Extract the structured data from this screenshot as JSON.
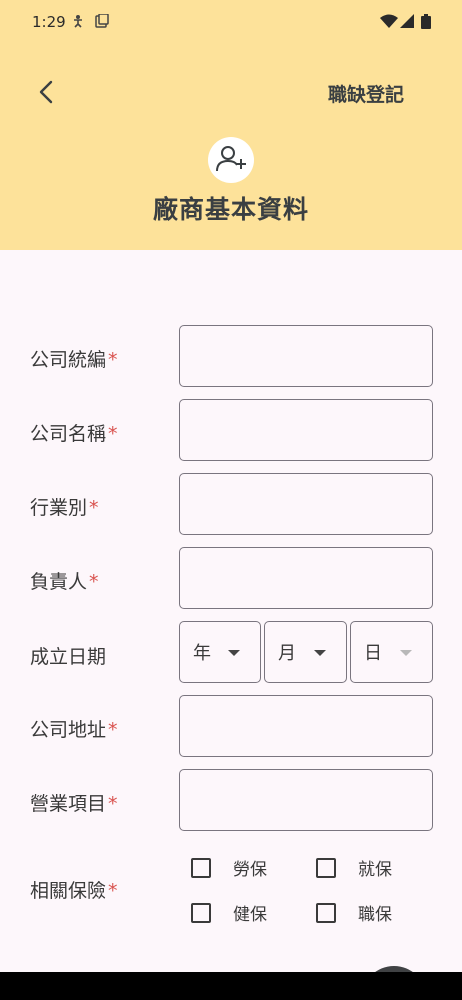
{
  "status_bar": {
    "time": "1:29"
  },
  "header": {
    "back_icon": "chevron-left-icon",
    "action_label": "職缺登記",
    "avatar_icon": "person-add-icon",
    "title": "廠商基本資料"
  },
  "form": {
    "required_mark": "*",
    "tax_id": {
      "label": "公司統編",
      "value": ""
    },
    "company_name": {
      "label": "公司名稱",
      "value": ""
    },
    "industry": {
      "label": "行業別",
      "value": ""
    },
    "owner": {
      "label": "負責人",
      "value": ""
    },
    "founded": {
      "label": "成立日期",
      "year": "年",
      "month": "月",
      "day": "日"
    },
    "address": {
      "label": "公司地址",
      "value": ""
    },
    "business_items": {
      "label": "營業項目",
      "value": ""
    },
    "insurance": {
      "label": "相關保險",
      "options": [
        "勞保",
        "就保",
        "健保",
        "職保"
      ]
    }
  },
  "colors": {
    "header_bg": "#fde29a",
    "required": "#d9534f",
    "page_bg": "#fdf7fb"
  }
}
